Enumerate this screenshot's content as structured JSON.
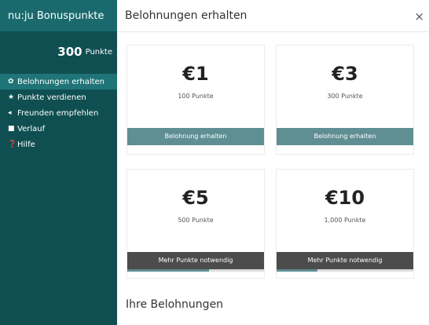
{
  "sidebar": {
    "title": "nu:ju Bonuspunkte",
    "points_value": "300",
    "points_unit": "Punkte",
    "items": [
      {
        "label": "Belohnungen erhalten",
        "icon": "gift-icon",
        "glyph": "✿",
        "active": true
      },
      {
        "label": "Punkte verdienen",
        "icon": "star-icon",
        "glyph": "★",
        "active": false
      },
      {
        "label": "Freunden empfehlen",
        "icon": "megaphone-icon",
        "glyph": "◂",
        "active": false
      },
      {
        "label": "Verlauf",
        "icon": "briefcase-icon",
        "glyph": "■",
        "active": false
      },
      {
        "label": "Hilfe",
        "icon": "help-icon",
        "glyph": "❓",
        "active": false
      }
    ]
  },
  "main": {
    "title": "Belohnungen erhalten",
    "close_glyph": "×",
    "rewards": [
      {
        "amount": "€1",
        "points": "100 Punkte",
        "button": "Belohnung erhalten",
        "state": "available",
        "progress": 1.0
      },
      {
        "amount": "€3",
        "points": "300 Punkte",
        "button": "Belohnung erhalten",
        "state": "available",
        "progress": 1.0
      },
      {
        "amount": "€5",
        "points": "500 Punkte",
        "button": "Mehr Punkte notwendig",
        "state": "locked",
        "progress": 0.6
      },
      {
        "amount": "€10",
        "points": "1,000 Punkte",
        "button": "Mehr Punkte notwendig",
        "state": "locked",
        "progress": 0.3
      }
    ],
    "section_title": "Ihre Belohnungen"
  },
  "colors": {
    "sidebar_bg": "#0f4f52",
    "sidebar_header_bg": "#1a6a6d",
    "button_available": "#5f8f93",
    "button_locked": "#4c4c4c"
  }
}
